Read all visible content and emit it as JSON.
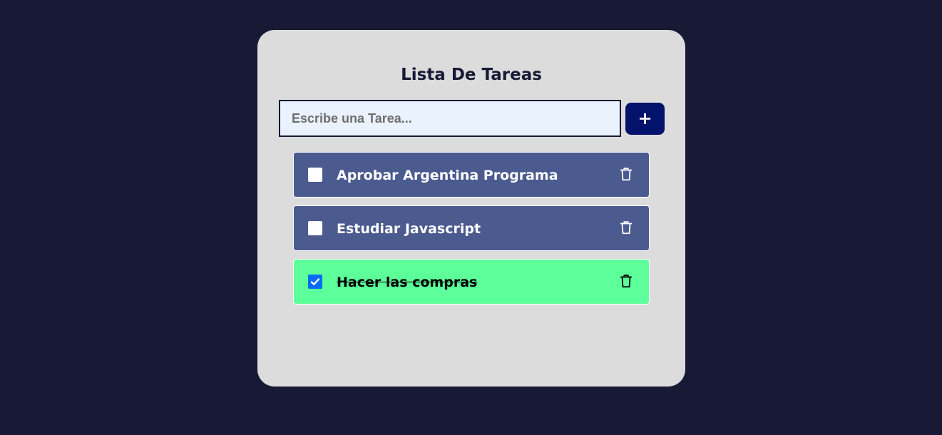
{
  "header": {
    "title": "Lista De Tareas"
  },
  "form": {
    "placeholder": "Escribe una Tarea...",
    "value": "",
    "add_label": "+"
  },
  "tasks": [
    {
      "text": "Aprobar Argentina Programa",
      "done": false
    },
    {
      "text": "Estudiar Javascript",
      "done": false
    },
    {
      "text": "Hacer las compras",
      "done": true
    }
  ],
  "icons": {
    "delete": "trash-icon",
    "checked": "checkmark-icon"
  },
  "colors": {
    "background": "#181935",
    "card": "#dcdcdc",
    "input": "#eaf2fe",
    "add_button": "#03136b",
    "task_pending": "#4b5a8f",
    "task_done": "#5cff9a",
    "checkbox_checked": "#0a6cf5"
  }
}
